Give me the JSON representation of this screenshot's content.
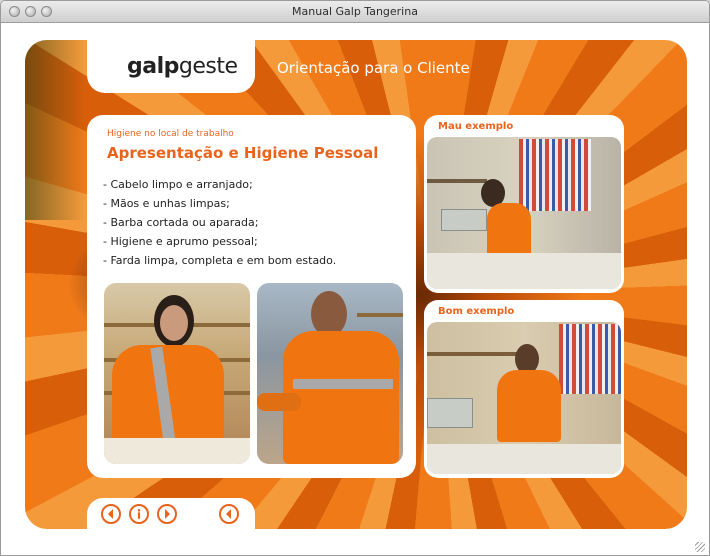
{
  "window": {
    "title": "Manual Galp Tangerina"
  },
  "brand": {
    "logo_bold": "galp",
    "logo_light": "geste"
  },
  "header": {
    "title": "Orientação para o Cliente"
  },
  "content": {
    "kicker": "Higiene no local de trabalho",
    "heading": "Apresentação e Higiene Pessoal",
    "bullets": [
      "- Cabelo limpo e arranjado;",
      "- Mãos e unhas limpas;",
      "- Barba cortada ou aparada;",
      "- Higiene e aprumo pessoal;",
      "- Farda limpa, completa e em bom estado."
    ]
  },
  "examples": {
    "bad_label": "Mau exemplo",
    "good_label": "Bom exemplo"
  },
  "nav": {
    "icons": [
      "back-icon",
      "info-icon",
      "forward-icon",
      "home-back-icon"
    ]
  },
  "colors": {
    "accent": "#e8641c",
    "uniform": "#f07410"
  }
}
